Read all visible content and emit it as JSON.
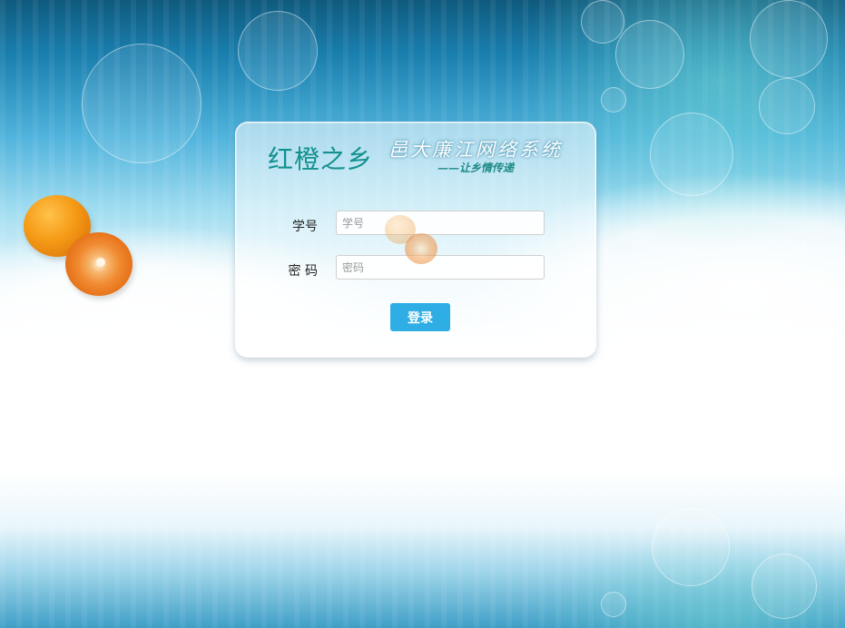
{
  "brand": {
    "name": "红橙之乡",
    "system_title": "邑大廉江网络系统",
    "slogan": "——让乡情传递"
  },
  "form": {
    "student_id_label": "学号",
    "student_id_placeholder": "学号",
    "student_id_value": "",
    "password_label": "密 码",
    "password_placeholder": "密码",
    "password_value": "",
    "login_label": "登录"
  },
  "colors": {
    "accent_button": "#2eaee4",
    "brand_text": "#13918f",
    "slogan_text": "#1c8a86"
  },
  "decor": {
    "background": "sky-blue gradient with clouds and bokeh",
    "images": [
      "whole-orange",
      "half-orange"
    ]
  }
}
